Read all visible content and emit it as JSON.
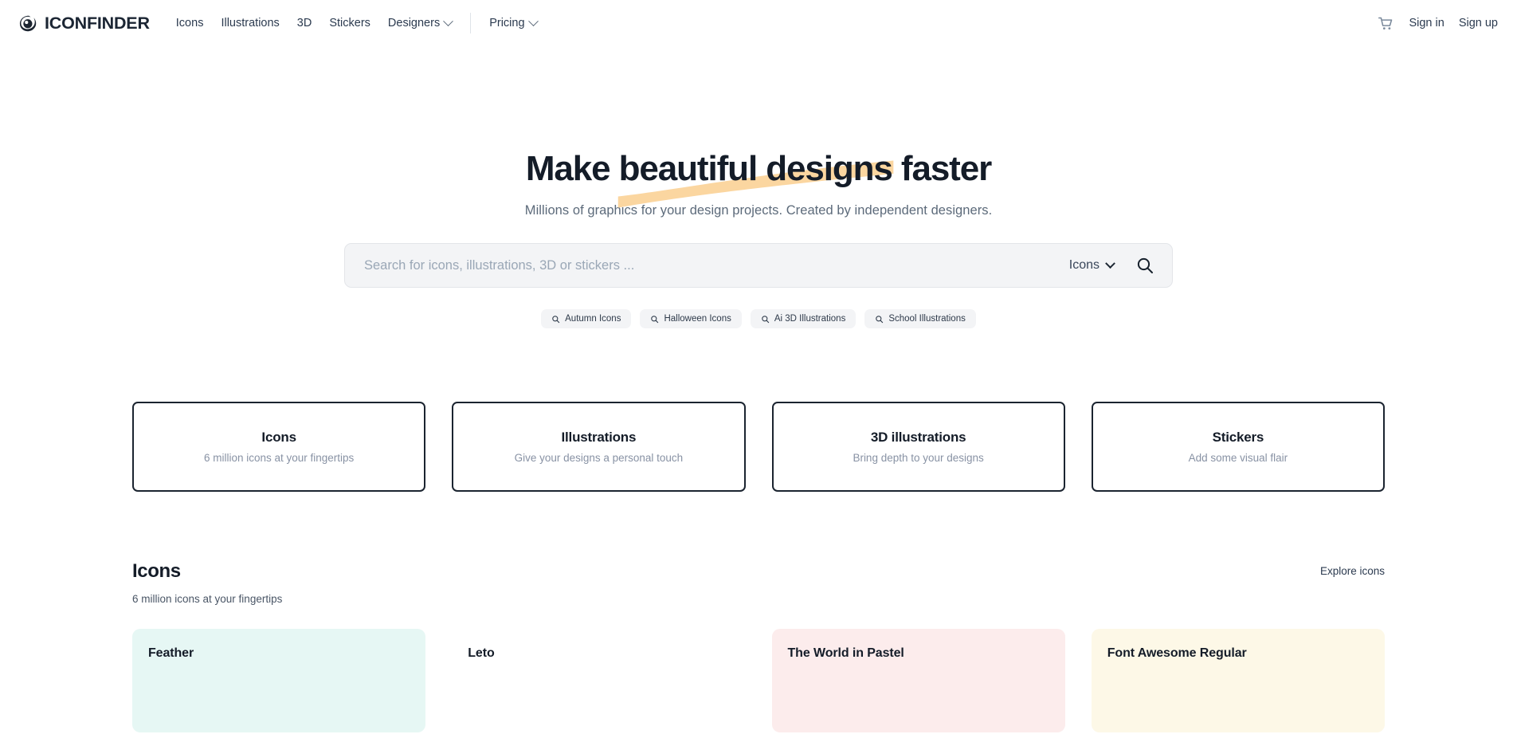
{
  "brand": {
    "name": "ICONFINDER",
    "logo_icon": "iconfinder-eye-logo"
  },
  "nav": {
    "items": [
      {
        "label": "Icons",
        "has_dropdown": false
      },
      {
        "label": "Illustrations",
        "has_dropdown": false
      },
      {
        "label": "3D",
        "has_dropdown": false
      },
      {
        "label": "Stickers",
        "has_dropdown": false
      },
      {
        "label": "Designers",
        "has_dropdown": true
      }
    ],
    "pricing": {
      "label": "Pricing",
      "has_dropdown": true
    }
  },
  "account": {
    "cart_icon": "shopping-cart-icon",
    "sign_in": "Sign in",
    "sign_up": "Sign up"
  },
  "hero": {
    "headline_part1": "Make ",
    "headline_highlight": "beautiful designs",
    "headline_part2": " faster",
    "highlight_color": "#fbd6a0",
    "subtitle": "Millions of graphics for your design projects. Created by independent designers."
  },
  "search": {
    "placeholder": "Search for icons, illustrations, 3D or stickers ...",
    "value": "",
    "type_selected": "Icons",
    "search_icon": "search-icon",
    "dropdown_icon": "chevron-down-icon"
  },
  "suggestions": [
    {
      "label": "Autumn Icons"
    },
    {
      "label": "Halloween Icons"
    },
    {
      "label": "Ai 3D Illustrations"
    },
    {
      "label": "School Illustrations"
    }
  ],
  "categories": [
    {
      "title": "Icons",
      "subtitle": "6 million icons at your fingertips"
    },
    {
      "title": "Illustrations",
      "subtitle": "Give your designs a personal touch"
    },
    {
      "title": "3D illustrations",
      "subtitle": "Bring depth to your designs"
    },
    {
      "title": "Stickers",
      "subtitle": "Add some visual flair"
    }
  ],
  "icons_section": {
    "title": "Icons",
    "subtitle": "6 million icons at your fingertips",
    "explore_label": "Explore icons",
    "sets": [
      {
        "name": "Feather",
        "bg": "#e6f7f4"
      },
      {
        "name": "Leto",
        "bg": "#ffffff"
      },
      {
        "name": "The World in Pastel",
        "bg": "#fcecec"
      },
      {
        "name": "Font Awesome Regular",
        "bg": "#fdf8e7"
      }
    ]
  }
}
